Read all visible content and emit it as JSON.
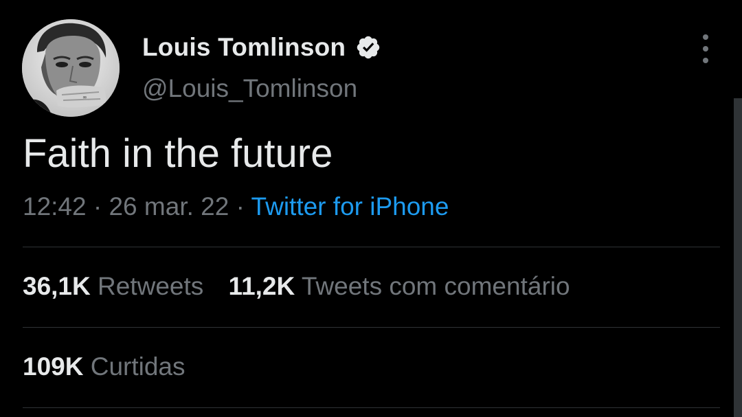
{
  "tweet": {
    "author": {
      "display_name": "Louis Tomlinson",
      "handle": "@Louis_Tomlinson",
      "verified": true
    },
    "text": "Faith in the future",
    "time": "12:42",
    "separator": " · ",
    "date": "26 mar. 22",
    "source": "Twitter for iPhone",
    "stats": {
      "retweets_value": "36,1K",
      "retweets_label": "Retweets",
      "quotes_value": "11,2K",
      "quotes_label": "Tweets com comentário",
      "likes_value": "109K",
      "likes_label": "Curtidas"
    }
  },
  "icons": {
    "verified": "verified-badge-icon",
    "more": "more-vertical-icon"
  },
  "colors": {
    "background": "#000000",
    "primary_text": "#e7e9ea",
    "secondary_text": "#71767b",
    "link": "#1d9bf0",
    "divider": "#2f3336"
  }
}
